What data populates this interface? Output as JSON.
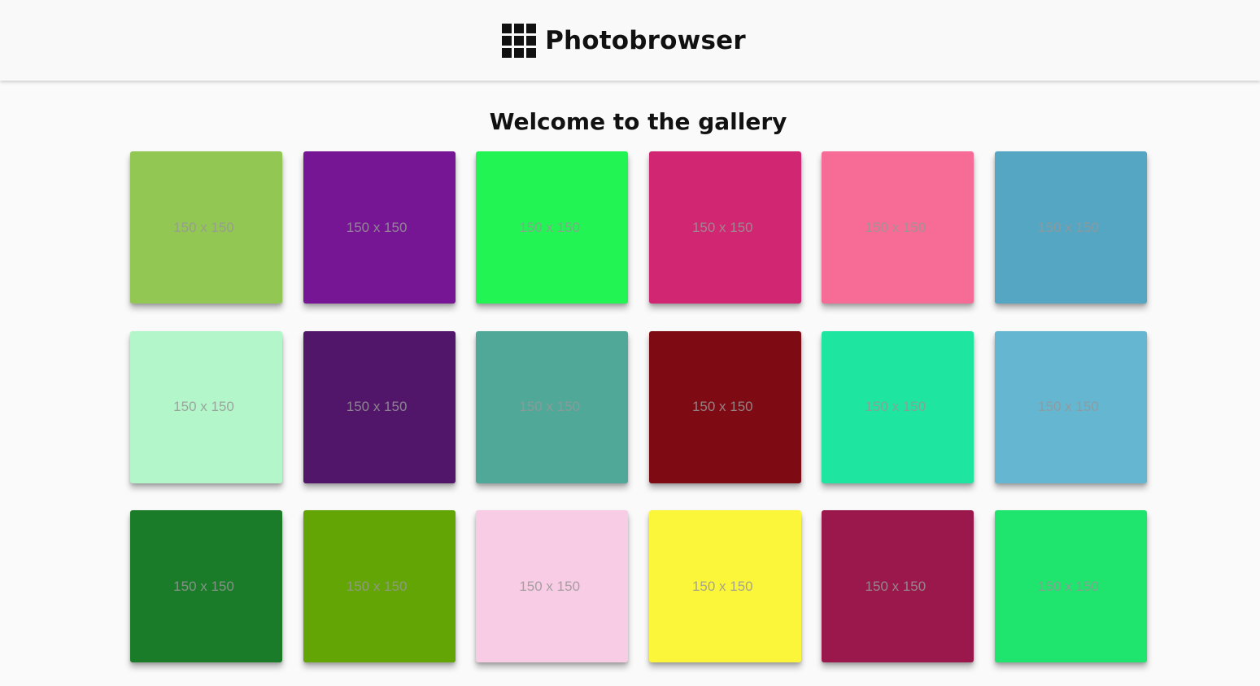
{
  "header": {
    "title": "Photobrowser",
    "icon": "grid-icon"
  },
  "main": {
    "heading": "Welcome to the gallery"
  },
  "gallery": {
    "photos": [
      {
        "label": "150 x 150",
        "color": "#92c754"
      },
      {
        "label": "150 x 150",
        "color": "#771694"
      },
      {
        "label": "150 x 150",
        "color": "#22f553"
      },
      {
        "label": "150 x 150",
        "color": "#d12671"
      },
      {
        "label": "150 x 150",
        "color": "#f76c96"
      },
      {
        "label": "150 x 150",
        "color": "#55a6c2"
      },
      {
        "label": "150 x 150",
        "color": "#b2f6c9"
      },
      {
        "label": "150 x 150",
        "color": "#511569"
      },
      {
        "label": "150 x 150",
        "color": "#50a998"
      },
      {
        "label": "150 x 150",
        "color": "#7e0b14"
      },
      {
        "label": "150 x 150",
        "color": "#1ee6a1"
      },
      {
        "label": "150 x 150",
        "color": "#65b6d0"
      },
      {
        "label": "150 x 150",
        "color": "#1a7c28"
      },
      {
        "label": "150 x 150",
        "color": "#62a505"
      },
      {
        "label": "150 x 150",
        "color": "#f8cce4"
      },
      {
        "label": "150 x 150",
        "color": "#fcf63b"
      },
      {
        "label": "150 x 150",
        "color": "#9b184c"
      },
      {
        "label": "150 x 150",
        "color": "#1fe46e"
      }
    ]
  }
}
